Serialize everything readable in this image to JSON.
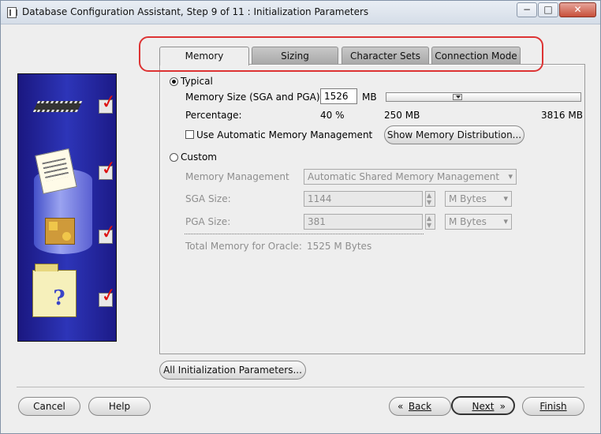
{
  "window": {
    "title": "Database Configuration Assistant, Step 9 of 11 : Initialization Parameters",
    "controls": {
      "minimize": "−",
      "maximize": "□",
      "close": "✕"
    }
  },
  "tabs": [
    {
      "label": "Memory",
      "active": true
    },
    {
      "label": "Sizing",
      "active": false
    },
    {
      "label": "Character Sets",
      "active": false
    },
    {
      "label": "Connection Mode",
      "active": false
    }
  ],
  "memory": {
    "typical_label": "Typical",
    "memory_size_label": "Memory Size (SGA and PGA):",
    "memory_size_value": "1526",
    "memory_size_unit": "MB",
    "percentage_label": "Percentage:",
    "percentage_value": "40 %",
    "slider_min": "250 MB",
    "slider_max": "3816 MB",
    "slider_position": 0.36,
    "automatic_label": "Use Automatic Memory Management",
    "show_distribution_button": "Show Memory Distribution...",
    "custom_label": "Custom",
    "memory_management_label": "Memory Management",
    "memory_management_value": "Automatic Shared Memory Management",
    "sga_size_label": "SGA Size:",
    "sga_size_value": "1144",
    "sga_unit": "M Bytes",
    "pga_size_label": "PGA Size:",
    "pga_size_value": "381",
    "pga_unit": "M Bytes",
    "total_memory_label": "Total Memory for Oracle:",
    "total_memory_value": "1525 M Bytes"
  },
  "buttons": {
    "all_parameters": "All Initialization Parameters...",
    "cancel": "Cancel",
    "help": "Help",
    "back": "Back",
    "next": "Next",
    "finish": "Finish"
  },
  "sidebar_icons": [
    "chip-icon",
    "documents-icon",
    "database-icon",
    "help-folder-icon"
  ],
  "colors": {
    "highlight": "#dd3333",
    "sidebar_blue": "#2d35b8",
    "check_red": "#dd1111"
  }
}
